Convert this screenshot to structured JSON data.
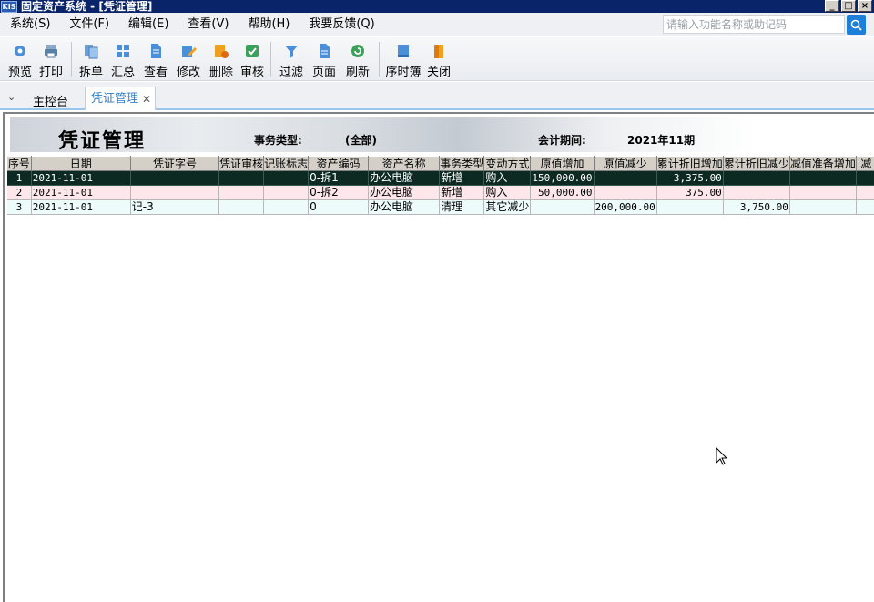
{
  "window": {
    "app_icon": "KIS",
    "title": "固定资产系统 - [凭证管理]"
  },
  "menu": {
    "items": [
      "系统(S)",
      "文件(F)",
      "编辑(E)",
      "查看(V)",
      "帮助(H)",
      "我要反馈(Q)"
    ],
    "search_placeholder": "请输入功能名称或助记码"
  },
  "toolbar": {
    "preview": "预览",
    "print": "打印",
    "unpack": "拆单",
    "summary": "汇总",
    "view": "查看",
    "modify": "修改",
    "delete": "删除",
    "audit": "审核",
    "filter": "过滤",
    "page": "页面",
    "refresh": "刷新",
    "ledger": "序时簿",
    "close": "关闭"
  },
  "tabs": {
    "home": "主控台",
    "active": "凭证管理"
  },
  "banner": {
    "title": "凭证管理",
    "type_label": "事务类型:",
    "type_value": "(全部)",
    "period_label": "会计期间:",
    "period_value": "2021年11期"
  },
  "grid": {
    "columns": [
      "序号",
      "日期",
      "凭证字号",
      "凭证审核",
      "记账标志",
      "资产编码",
      "资产名称",
      "事务类型",
      "变动方式",
      "原值增加",
      "原值减少",
      "累计折旧增加",
      "累计折旧减少",
      "减值准备增加",
      "减"
    ],
    "rows": [
      [
        "1",
        "2021-11-01",
        "",
        "",
        "",
        "0-拆1",
        "办公电脑",
        "新增",
        "购入",
        "150,000.00",
        "",
        "3,375.00",
        "",
        "",
        ""
      ],
      [
        "2",
        "2021-11-01",
        "",
        "",
        "",
        "0-拆2",
        "办公电脑",
        "新增",
        "购入",
        "50,000.00",
        "",
        "375.00",
        "",
        "",
        ""
      ],
      [
        "3",
        "2021-11-01",
        "记-3",
        "",
        "",
        "0",
        "办公电脑",
        "清理",
        "其它减少",
        "",
        "200,000.00",
        "",
        "3,750.00",
        "",
        ""
      ]
    ]
  }
}
